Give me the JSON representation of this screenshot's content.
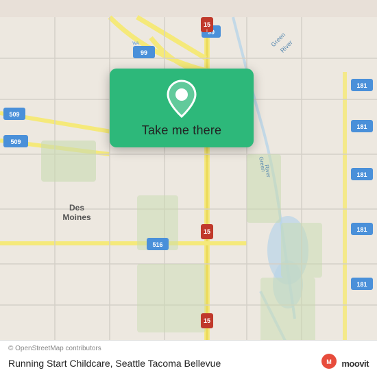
{
  "map": {
    "alt": "Map of Seattle Tacoma Bellevue area",
    "copyright": "© OpenStreetMap contributors"
  },
  "card": {
    "button_label": "Take me there",
    "location_icon": "location-pin"
  },
  "bottom_bar": {
    "copyright": "© OpenStreetMap contributors",
    "location_name": "Running Start Childcare, Seattle Tacoma Bellevue",
    "moovit_label": "moovit"
  }
}
